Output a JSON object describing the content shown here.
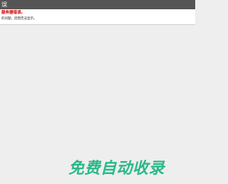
{
  "titlebar": {
    "title": "误"
  },
  "error": {
    "heading": "服务器错误。",
    "detail": "的问题，因而无法显示。"
  },
  "watermark": {
    "text": "免费自动收录"
  }
}
